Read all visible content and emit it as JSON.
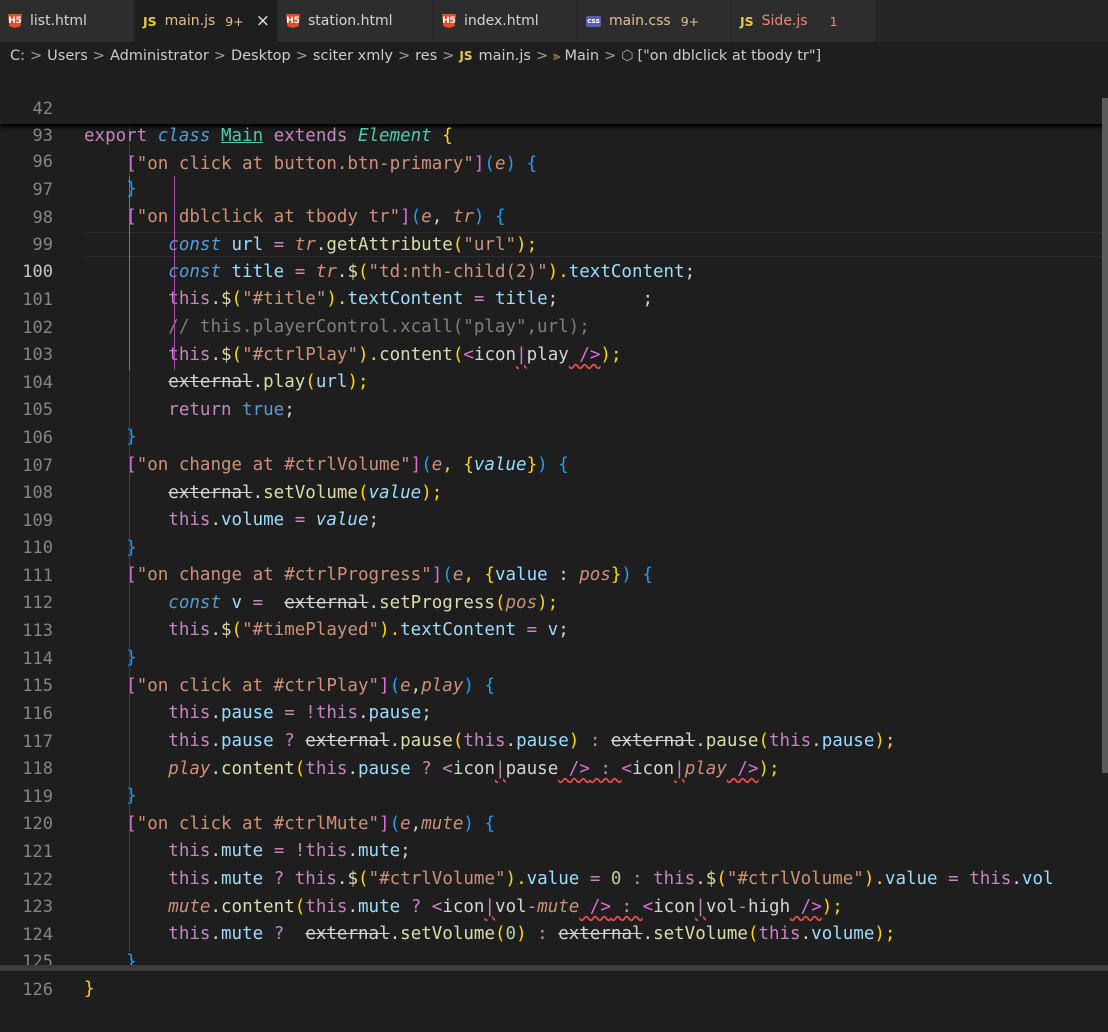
{
  "tabs": [
    {
      "icon": "html",
      "label": "list.html",
      "modified": "",
      "close": ""
    },
    {
      "icon": "js",
      "label": "main.js",
      "modified": "9+",
      "close": "×",
      "active": true
    },
    {
      "icon": "html",
      "label": "station.html",
      "modified": "",
      "close": ""
    },
    {
      "icon": "html",
      "label": "index.html",
      "modified": "",
      "close": ""
    },
    {
      "icon": "css",
      "label": "main.css",
      "modified": "9+",
      "close": ""
    },
    {
      "icon": "js",
      "label": "Side.js",
      "modified": "1",
      "close": ""
    }
  ],
  "icons": {
    "html": "H5",
    "js": "JS",
    "css": "css"
  },
  "breadcrumb": {
    "drive": "C:",
    "users": "Users",
    "admin": "Administrator",
    "desktop": "Desktop",
    "project": "sciter xmly",
    "res": "res",
    "jsmark": "JS",
    "file": "main.js",
    "cls": "Main",
    "method": "[\"on dblclick at tbody tr\"]",
    "sep": ">"
  },
  "line_numbers": [
    "42",
    "93",
    "96",
    "97",
    "98",
    "99",
    "100",
    "101",
    "102",
    "103",
    "104",
    "105",
    "106",
    "107",
    "108",
    "109",
    "110",
    "111",
    "112",
    "113",
    "114",
    "115",
    "116",
    "117",
    "118",
    "119",
    "120",
    "121",
    "122",
    "123",
    "124",
    "125",
    "126"
  ],
  "code": {
    "l42": [
      "export ",
      "class ",
      "Main",
      " extends ",
      "Element",
      " {"
    ],
    "l93": [
      "[",
      "\"on click at button.btn-primary\"",
      "]",
      "(",
      "e",
      ") {"
    ],
    "l96": [
      "}"
    ],
    "l97": [
      "[",
      "\"on dblclick at tbody tr\"",
      "]",
      "(",
      "e",
      ", ",
      "tr",
      ") {"
    ],
    "l98": [
      "const ",
      "url",
      " = ",
      "tr",
      ".",
      "getAttribute",
      "(",
      "\"url\"",
      ");"
    ],
    "l99": [
      "const ",
      "title",
      " = ",
      "tr",
      ".",
      "$",
      "(",
      "\"td:nth-child(2)\"",
      ").",
      "textContent",
      ";"
    ],
    "l100": [
      "this",
      ".",
      "$",
      "(",
      "\"#title\"",
      ").",
      "textContent",
      " = ",
      "title",
      ";",
      "        ;"
    ],
    "l101": [
      "// this.playerControl.xcall(\"play\",url);"
    ],
    "l102": [
      "this",
      ".",
      "$",
      "(",
      "\"#ctrlPlay\"",
      ").",
      "content",
      "(",
      "<",
      "icon",
      "|",
      "play",
      " />",
      ");"
    ],
    "l103": [
      "external",
      ".",
      "play",
      "(",
      "url",
      ");"
    ],
    "l104": [
      "return ",
      "true",
      ";"
    ],
    "l105": [
      "}"
    ],
    "l106": [
      "[",
      "\"on change at #ctrlVolume\"",
      "]",
      "(",
      "e",
      ", {",
      "value",
      "}",
      ") {"
    ],
    "l107": [
      "external",
      ".",
      "setVolume",
      "(",
      "value",
      ");"
    ],
    "l108": [
      "this",
      ".",
      "volume",
      " = ",
      "value",
      ";"
    ],
    "l109": [
      "}"
    ],
    "l110": [
      "[",
      "\"on change at #ctrlProgress\"",
      "]",
      "(",
      "e",
      ", {",
      "value",
      " : ",
      "pos",
      "}",
      ") {"
    ],
    "l111": [
      "const ",
      "v",
      " =  ",
      "external",
      ".",
      "setProgress",
      "(",
      "pos",
      ");"
    ],
    "l112": [
      "this",
      ".",
      "$",
      "(",
      "\"#timePlayed\"",
      ").",
      "textContent",
      " = ",
      "v",
      ";"
    ],
    "l113": [
      "}"
    ],
    "l114": [
      "[",
      "\"on click at #ctrlPlay\"",
      "]",
      "(",
      "e",
      ",",
      "play",
      ") {"
    ],
    "l115": [
      "this",
      ".",
      "pause",
      " = !",
      "this",
      ".",
      "pause",
      ";"
    ],
    "l116": [
      "this",
      ".",
      "pause",
      " ? ",
      "external",
      ".",
      "pause",
      "(",
      "this",
      ".",
      "pause",
      ")",
      " : ",
      "external",
      ".",
      "pause",
      "(",
      "this",
      ".",
      "pause",
      ");"
    ],
    "l117": [
      "play",
      ".",
      "content",
      "(",
      "this",
      ".",
      "pause",
      " ? <",
      "icon",
      "|",
      "pause",
      " />",
      " : ",
      "<",
      "icon",
      "|",
      "play",
      " />",
      ");"
    ],
    "l118": [
      "}"
    ],
    "l119": [
      "[",
      "\"on click at #ctrlMute\"",
      "]",
      "(",
      "e",
      ",",
      "mute",
      ") {"
    ],
    "l120": [
      "this",
      ".",
      "mute",
      " = !",
      "this",
      ".",
      "mute",
      ";"
    ],
    "l121": [
      "this",
      ".",
      "mute",
      " ? ",
      "this",
      ".",
      "$",
      "(",
      "\"#ctrlVolume\"",
      ").",
      "value",
      " = ",
      "0",
      " : ",
      "this",
      ".",
      "$",
      "(",
      "\"#ctrlVolume\"",
      ").",
      "value",
      " = ",
      "this",
      ".",
      "vol"
    ],
    "l122": [
      "mute",
      ".",
      "content",
      "(",
      "this",
      ".",
      "mute",
      " ? <",
      "icon",
      "|",
      "vol",
      "-",
      "mute",
      " />",
      " : ",
      "<",
      "icon",
      "|",
      "vol",
      "-",
      "high",
      " />",
      ");"
    ],
    "l123": [
      "this",
      ".",
      "mute",
      " ?  ",
      "external",
      ".",
      "setVolume",
      "(",
      "0",
      ")",
      " : ",
      "external",
      ".",
      "setVolume",
      "(",
      "this",
      ".",
      "volume",
      ");"
    ],
    "l124": [
      "}"
    ],
    "l125": [
      "}"
    ]
  },
  "colors": {
    "background": "#1e1e1e",
    "tabbar": "#252526",
    "keyword": "#c586c0",
    "storage": "#569cd6",
    "string": "#ce9178",
    "function": "#dcdcaa",
    "variable": "#9cdcfe",
    "class": "#4ec9b0",
    "comment": "#6a9955",
    "modified": "#e2c08d",
    "error": "#f48771"
  }
}
